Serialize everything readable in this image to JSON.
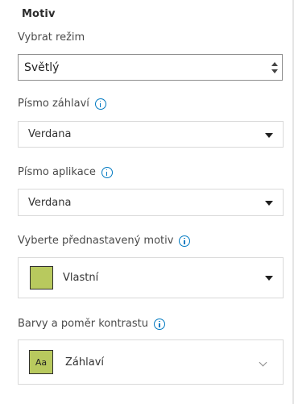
{
  "panel": {
    "title": "Motiv"
  },
  "mode": {
    "label": "Vybrat režim",
    "value": "Světlý"
  },
  "header_font": {
    "label": "Písmo záhlaví",
    "value": "Verdana",
    "info_icon": "info-icon"
  },
  "app_font": {
    "label": "Písmo aplikace",
    "value": "Verdana",
    "info_icon": "info-icon"
  },
  "preset_theme": {
    "label": "Vyberte přednastavený motiv",
    "value": "Vlastní",
    "swatch_color": "#b8c95e",
    "info_icon": "info-icon"
  },
  "colors_contrast": {
    "label": "Barvy a poměr kontrastu",
    "item_label": "Záhlaví",
    "swatch_text": "Aa",
    "swatch_color": "#b8c95e",
    "info_icon": "info-icon",
    "expand_icon": "chevron-down-icon"
  },
  "colors": {
    "accent_info": "#0079c1",
    "divider": "#e4e4e4"
  }
}
